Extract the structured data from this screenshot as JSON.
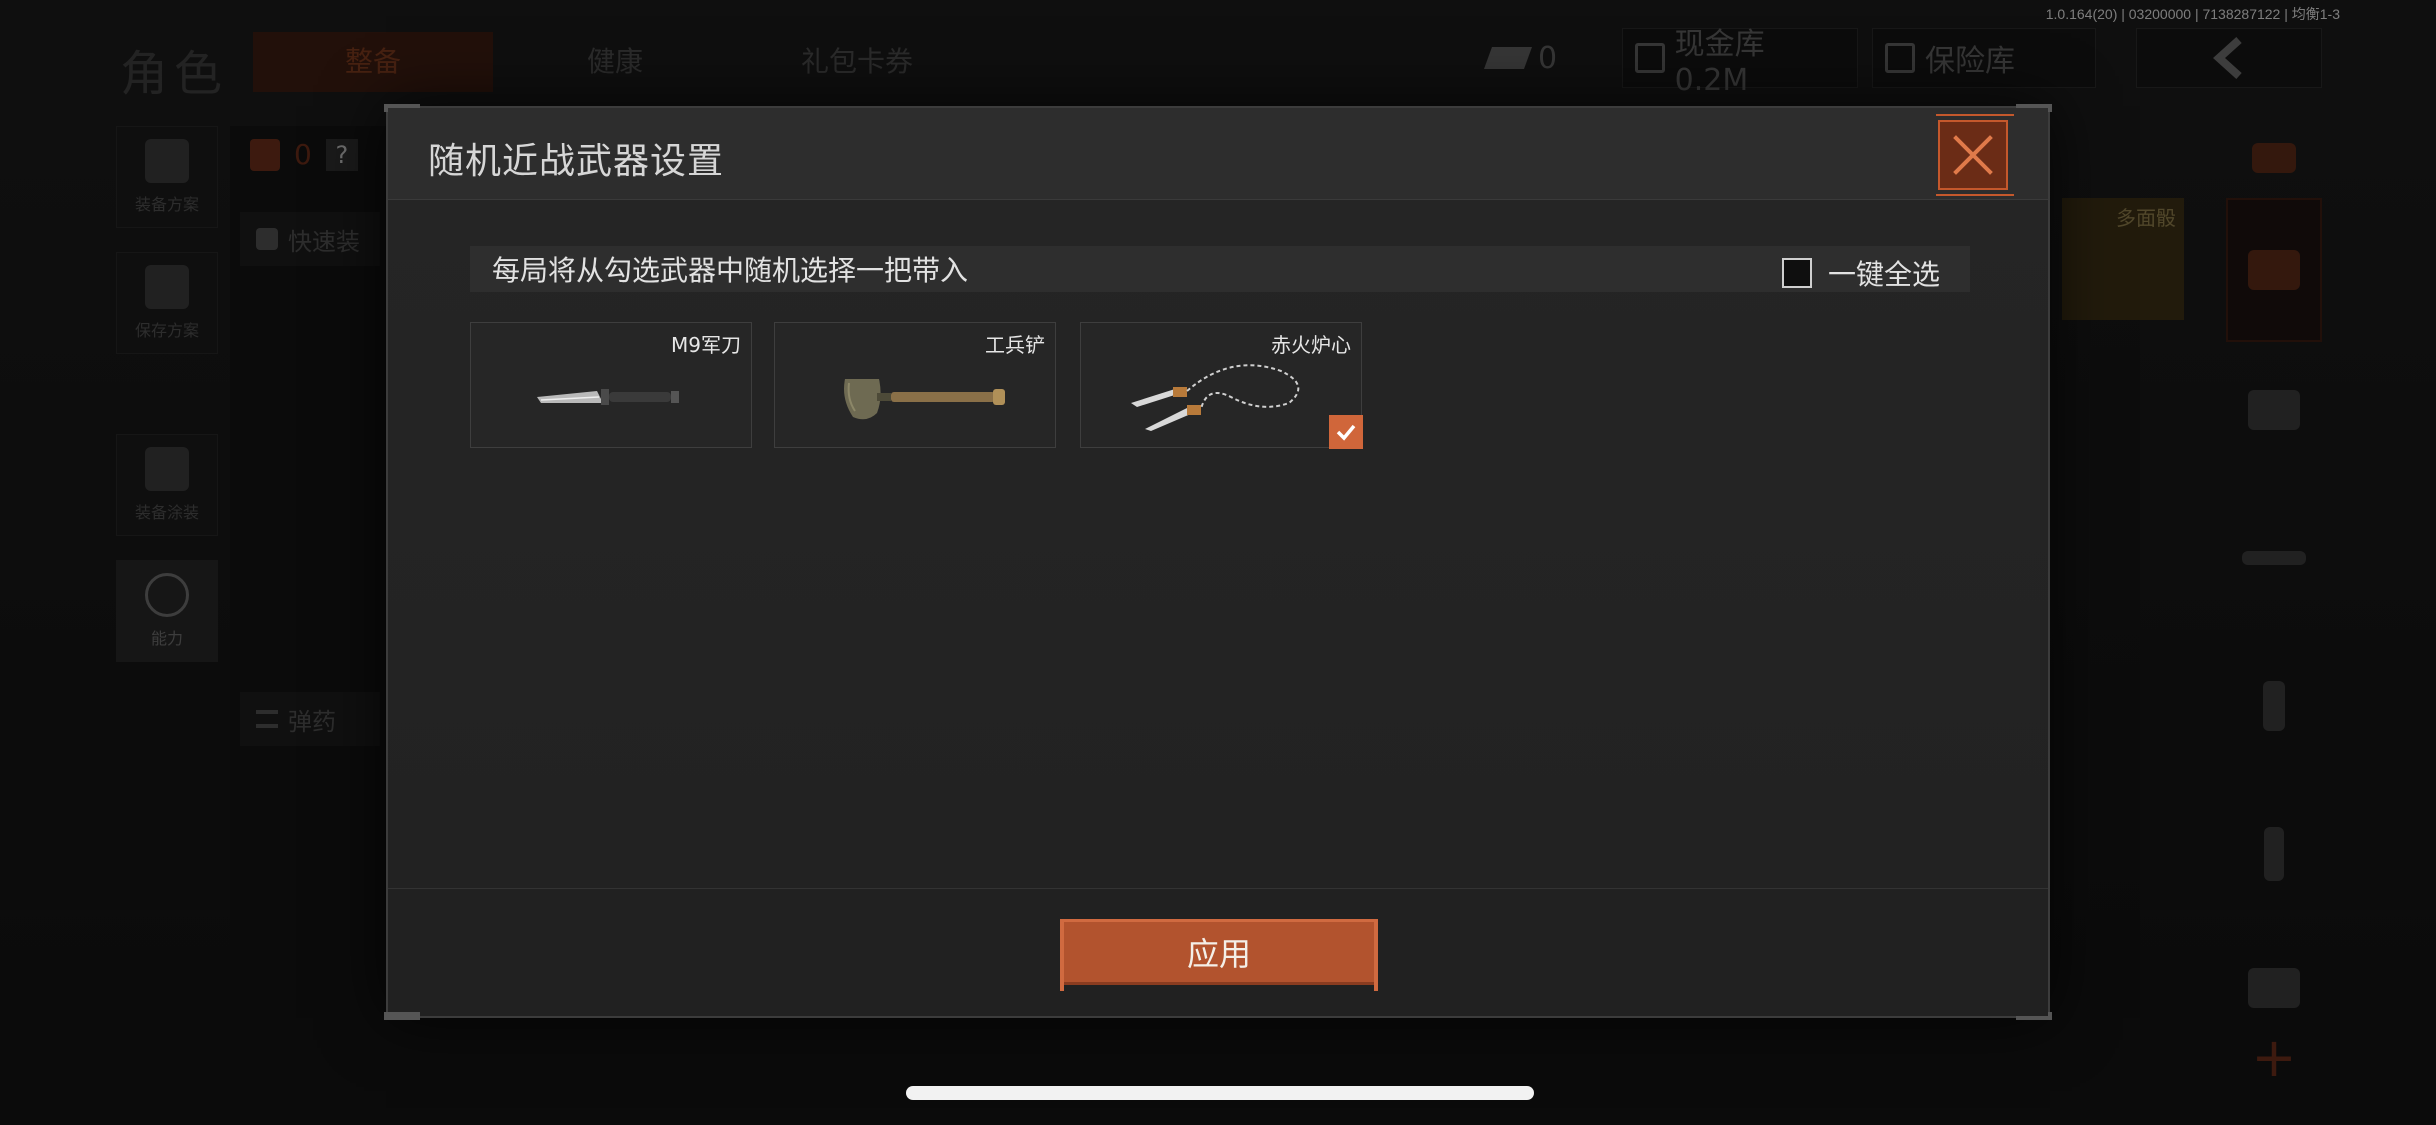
{
  "version_text": "1.0.164(20) | 03200000 | 7138287122 | 均衡1-3",
  "background": {
    "role_title": "角色",
    "tabs": [
      "整备",
      "健康",
      "礼包卡券"
    ],
    "ticket_count": "0",
    "cash_label": "现金库 0.2M",
    "safe_label": "保险库",
    "left_buttons": [
      "装备方案",
      "保存方案",
      "装备涂装",
      "能力"
    ],
    "left_panel": {
      "count": "0",
      "unknown_mark": "?",
      "quick_label": "快速装",
      "ammo_label": "弹药"
    },
    "promo_label": "多面骰"
  },
  "modal": {
    "title": "随机近战武器设置",
    "hint": "每局将从勾选武器中随机选择一把带入",
    "select_all_label": "一键全选",
    "select_all_checked": false,
    "weapons": [
      {
        "name": "M9军刀",
        "checked": false
      },
      {
        "name": "工兵铲",
        "checked": false
      },
      {
        "name": "赤火炉心",
        "checked": true
      }
    ],
    "apply_label": "应用"
  },
  "colors": {
    "accent": "#d0663a",
    "apply_button": "#b2532e",
    "close_button": "#6b2c16",
    "modal_bg": "#262626"
  }
}
